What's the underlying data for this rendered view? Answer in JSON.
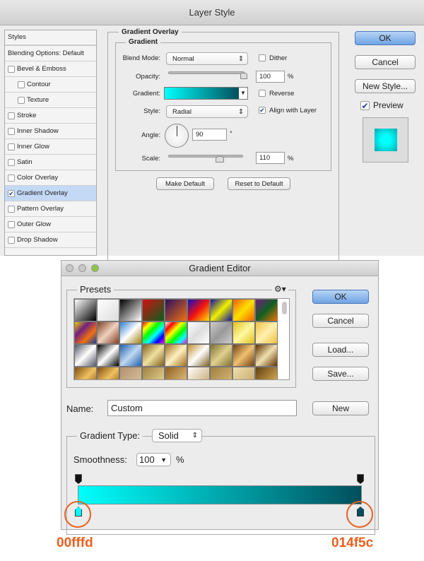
{
  "layer_style": {
    "title": "Layer Style",
    "styles_header": "Styles",
    "blending": "Blending Options: Default",
    "items": [
      {
        "label": "Bevel & Emboss",
        "checked": false,
        "indent": false
      },
      {
        "label": "Contour",
        "checked": false,
        "indent": true
      },
      {
        "label": "Texture",
        "checked": false,
        "indent": true
      },
      {
        "label": "Stroke",
        "checked": false,
        "indent": false
      },
      {
        "label": "Inner Shadow",
        "checked": false,
        "indent": false
      },
      {
        "label": "Inner Glow",
        "checked": false,
        "indent": false
      },
      {
        "label": "Satin",
        "checked": false,
        "indent": false
      },
      {
        "label": "Color Overlay",
        "checked": false,
        "indent": false
      },
      {
        "label": "Gradient Overlay",
        "checked": true,
        "indent": false,
        "selected": true
      },
      {
        "label": "Pattern Overlay",
        "checked": false,
        "indent": false
      },
      {
        "label": "Outer Glow",
        "checked": false,
        "indent": false
      },
      {
        "label": "Drop Shadow",
        "checked": false,
        "indent": false
      }
    ],
    "section": "Gradient Overlay",
    "subsection": "Gradient",
    "blend_mode_label": "Blend Mode:",
    "blend_mode": "Normal",
    "dither": "Dither",
    "opacity_label": "Opacity:",
    "opacity": "100",
    "pct": "%",
    "gradient_label": "Gradient:",
    "reverse": "Reverse",
    "style_label": "Style:",
    "style": "Radial",
    "align": "Align with Layer",
    "angle_label": "Angle:",
    "angle": "90",
    "deg": "°",
    "scale_label": "Scale:",
    "scale": "110",
    "make_default": "Make Default",
    "reset_default": "Reset to Default",
    "ok": "OK",
    "cancel": "Cancel",
    "new_style": "New Style...",
    "preview": "Preview"
  },
  "gradient_editor": {
    "title": "Gradient Editor",
    "presets": "Presets",
    "ok": "OK",
    "cancel": "Cancel",
    "load": "Load...",
    "save": "Save...",
    "name_label": "Name:",
    "name": "Custom",
    "new": "New",
    "type_label": "Gradient Type:",
    "type": "Solid",
    "smooth_label": "Smoothness:",
    "smooth": "100",
    "pct": "%",
    "presets_list": [
      "#fff,#000",
      "#fff,#ddd",
      "#000,#fff",
      "#d01010,#0a6020",
      "#2a1060,#f07010",
      "#1010c0,#f01010,#ffe000",
      "#1010a0,#f0f000,#1010a0",
      "#f06000,#ffe000,#f06000",
      "#702080,#106020,#f07000",
      "#f0d000,#702080,#f07010,#1040a0",
      "#804020,#f0d0c0,#804020",
      "#3080d0,#fff,#a08010",
      "#f00,#ff0,#0f0,#0ff,#00f,#f0f",
      "#fff,#f00,#ff0,#0f0,#0ff,#f0f",
      "#fff,#ddd,#fff",
      "#ccc,#999,#ccc",
      "#e0c020,#fff8a0,#e0c020",
      "#f0c040,#fff0b0,#f0c040",
      "#556,#fff,#556",
      "#000,#fff,#000",
      "#2060b0,#c0d8f0,#2060b0",
      "#806020,#f0e0a0,#806020",
      "#a07020,#fff0c0,#a07020",
      "#c09030,#fff,#806020",
      "#807030,#e0d090,#807030",
      "#704010,#f0c070,#704010",
      "#603000,#f0e0b0,#603000",
      "#805010,#f0c060,#805010",
      "#805010,#f0c060,#805010",
      "#b09070,#e0c8a0",
      "#a08040,#f0e0a0",
      "#906020,#f0d090",
      "#fff,#c0a060",
      "#a08040,#e0c080",
      "#f0e0b0,#c0a060",
      "#604010,#f0c060"
    ],
    "stop_left": "00fffd",
    "stop_right": "014f5c"
  },
  "colors": {
    "start": "#00fffd",
    "end": "#014f5c",
    "accent": "#e8611f"
  }
}
